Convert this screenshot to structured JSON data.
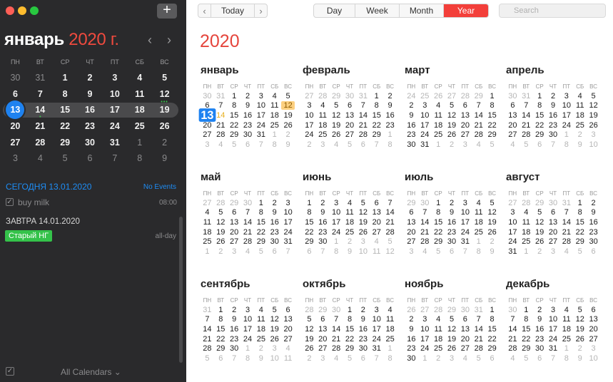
{
  "sidebar": {
    "add_label": "+",
    "mini_month": "январь",
    "mini_year": "2020 г.",
    "prev": "‹",
    "next": "›",
    "weekdays": [
      "ПН",
      "ВТ",
      "СР",
      "ЧТ",
      "ПТ",
      "СБ",
      "ВС"
    ],
    "weeks": [
      [
        {
          "d": "30",
          "out": true
        },
        {
          "d": "31",
          "out": true
        },
        {
          "d": "1"
        },
        {
          "d": "2"
        },
        {
          "d": "3"
        },
        {
          "d": "4"
        },
        {
          "d": "5"
        }
      ],
      [
        {
          "d": "6"
        },
        {
          "d": "7"
        },
        {
          "d": "8"
        },
        {
          "d": "9"
        },
        {
          "d": "10"
        },
        {
          "d": "11"
        },
        {
          "d": "12",
          "dots": "•••"
        }
      ],
      [
        {
          "d": "13",
          "today": true
        },
        {
          "d": "14",
          "dot": "•"
        },
        {
          "d": "15"
        },
        {
          "d": "16"
        },
        {
          "d": "17"
        },
        {
          "d": "18"
        },
        {
          "d": "19"
        }
      ],
      [
        {
          "d": "20"
        },
        {
          "d": "21"
        },
        {
          "d": "22"
        },
        {
          "d": "23"
        },
        {
          "d": "24"
        },
        {
          "d": "25"
        },
        {
          "d": "26"
        }
      ],
      [
        {
          "d": "27"
        },
        {
          "d": "28"
        },
        {
          "d": "29"
        },
        {
          "d": "30"
        },
        {
          "d": "31"
        },
        {
          "d": "1",
          "out": true
        },
        {
          "d": "2",
          "out": true
        }
      ],
      [
        {
          "d": "3",
          "out": true
        },
        {
          "d": "4",
          "out": true
        },
        {
          "d": "5",
          "out": true
        },
        {
          "d": "6",
          "out": true
        },
        {
          "d": "7",
          "out": true
        },
        {
          "d": "8",
          "out": true
        },
        {
          "d": "9",
          "out": true
        }
      ]
    ],
    "today_header": "СЕГОДНЯ 13.01.2020",
    "no_events": "No Events",
    "event1": {
      "title": "buy milk",
      "time": "08:00"
    },
    "tomorrow_header": "ЗАВТРА 14.01.2020",
    "event2": {
      "title": "Старый НГ",
      "time": "all-day"
    },
    "all_calendars": "All Calendars ⌄"
  },
  "toolbar": {
    "prev": "‹",
    "today": "Today",
    "next": "›",
    "views": [
      "Day",
      "Week",
      "Month",
      "Year"
    ],
    "active_view": "Year",
    "search_placeholder": "Search"
  },
  "year": "2020",
  "weekdays_short": [
    "ПН",
    "ВТ",
    "СР",
    "ЧТ",
    "ПТ",
    "СБ",
    "ВС"
  ],
  "months": [
    {
      "name": "январь",
      "weeks": [
        [
          "30*",
          "31*",
          "1",
          "2",
          "3",
          "4",
          "5"
        ],
        [
          "6",
          "7",
          "8",
          "9",
          "10",
          "11",
          "12y"
        ],
        [
          "13t",
          "14f",
          "15",
          "16",
          "17",
          "18",
          "19"
        ],
        [
          "20",
          "21",
          "22",
          "23",
          "24",
          "25",
          "26"
        ],
        [
          "27",
          "28",
          "29",
          "30",
          "31",
          "1*",
          "2*"
        ],
        [
          "3*",
          "4*",
          "5*",
          "6*",
          "7*",
          "8*",
          "9*"
        ]
      ]
    },
    {
      "name": "февраль",
      "weeks": [
        [
          "27*",
          "28*",
          "29*",
          "30*",
          "31*",
          "1",
          "2"
        ],
        [
          "3",
          "4",
          "5",
          "6",
          "7",
          "8",
          "9"
        ],
        [
          "10",
          "11",
          "12",
          "13",
          "14",
          "15",
          "16"
        ],
        [
          "17",
          "18",
          "19",
          "20",
          "21",
          "22",
          "23"
        ],
        [
          "24",
          "25",
          "26",
          "27",
          "28",
          "29",
          "1*"
        ],
        [
          "2*",
          "3*",
          "4*",
          "5*",
          "6*",
          "7*",
          "8*"
        ]
      ]
    },
    {
      "name": "март",
      "weeks": [
        [
          "24*",
          "25*",
          "26*",
          "27*",
          "28*",
          "29*",
          "1"
        ],
        [
          "2",
          "3",
          "4",
          "5",
          "6",
          "7",
          "8"
        ],
        [
          "9",
          "10",
          "11",
          "12",
          "13",
          "14",
          "15"
        ],
        [
          "16",
          "17",
          "18",
          "19",
          "20",
          "21",
          "22"
        ],
        [
          "23",
          "24",
          "25",
          "26",
          "27",
          "28",
          "29"
        ],
        [
          "30",
          "31",
          "1*",
          "2*",
          "3*",
          "4*",
          "5*"
        ]
      ]
    },
    {
      "name": "апрель",
      "weeks": [
        [
          "30*",
          "31*",
          "1",
          "2",
          "3",
          "4",
          "5"
        ],
        [
          "6",
          "7",
          "8",
          "9",
          "10",
          "11",
          "12"
        ],
        [
          "13",
          "14",
          "15",
          "16",
          "17",
          "18",
          "19"
        ],
        [
          "20",
          "21",
          "22",
          "23",
          "24",
          "25",
          "26"
        ],
        [
          "27",
          "28",
          "29",
          "30",
          "1*",
          "2*",
          "3*"
        ],
        [
          "4*",
          "5*",
          "6*",
          "7*",
          "8*",
          "9*",
          "10*"
        ]
      ]
    },
    {
      "name": "май",
      "weeks": [
        [
          "27*",
          "28*",
          "29*",
          "30*",
          "1",
          "2",
          "3"
        ],
        [
          "4",
          "5",
          "6",
          "7",
          "8",
          "9",
          "10"
        ],
        [
          "11",
          "12",
          "13",
          "14",
          "15",
          "16",
          "17"
        ],
        [
          "18",
          "19",
          "20",
          "21",
          "22",
          "23",
          "24"
        ],
        [
          "25",
          "26",
          "27",
          "28",
          "29",
          "30",
          "31"
        ],
        [
          "1*",
          "2*",
          "3*",
          "4*",
          "5*",
          "6*",
          "7*"
        ]
      ]
    },
    {
      "name": "июнь",
      "weeks": [
        [
          "1",
          "2",
          "3",
          "4",
          "5",
          "6",
          "7"
        ],
        [
          "8",
          "9",
          "10",
          "11",
          "12",
          "13",
          "14"
        ],
        [
          "15",
          "16",
          "17",
          "18",
          "19",
          "20",
          "21"
        ],
        [
          "22",
          "23",
          "24",
          "25",
          "26",
          "27",
          "28"
        ],
        [
          "29",
          "30",
          "1*",
          "2*",
          "3*",
          "4*",
          "5*"
        ],
        [
          "6*",
          "7*",
          "8*",
          "9*",
          "10*",
          "11*",
          "12*"
        ]
      ]
    },
    {
      "name": "июль",
      "weeks": [
        [
          "29*",
          "30*",
          "1",
          "2",
          "3",
          "4",
          "5"
        ],
        [
          "6",
          "7",
          "8",
          "9",
          "10",
          "11",
          "12"
        ],
        [
          "13",
          "14",
          "15",
          "16",
          "17",
          "18",
          "19"
        ],
        [
          "20",
          "21",
          "22",
          "23",
          "24",
          "25",
          "26"
        ],
        [
          "27",
          "28",
          "29",
          "30",
          "31",
          "1*",
          "2*"
        ],
        [
          "3*",
          "4*",
          "5*",
          "6*",
          "7*",
          "8*",
          "9*"
        ]
      ]
    },
    {
      "name": "август",
      "weeks": [
        [
          "27*",
          "28*",
          "29*",
          "30*",
          "31*",
          "1",
          "2"
        ],
        [
          "3",
          "4",
          "5",
          "6",
          "7",
          "8",
          "9"
        ],
        [
          "10",
          "11",
          "12",
          "13",
          "14",
          "15",
          "16"
        ],
        [
          "17",
          "18",
          "19",
          "20",
          "21",
          "22",
          "23"
        ],
        [
          "24",
          "25",
          "26",
          "27",
          "28",
          "29",
          "30"
        ],
        [
          "31",
          "1*",
          "2*",
          "3*",
          "4*",
          "5*",
          "6*"
        ]
      ]
    },
    {
      "name": "сентябрь",
      "weeks": [
        [
          "31*",
          "1",
          "2",
          "3",
          "4",
          "5",
          "6"
        ],
        [
          "7",
          "8",
          "9",
          "10",
          "11",
          "12",
          "13"
        ],
        [
          "14",
          "15",
          "16",
          "17",
          "18",
          "19",
          "20"
        ],
        [
          "21",
          "22",
          "23",
          "24",
          "25",
          "26",
          "27"
        ],
        [
          "28",
          "29",
          "30",
          "1*",
          "2*",
          "3*",
          "4*"
        ],
        [
          "5*",
          "6*",
          "7*",
          "8*",
          "9*",
          "10*",
          "11*"
        ]
      ]
    },
    {
      "name": "октябрь",
      "weeks": [
        [
          "28*",
          "29*",
          "30*",
          "1",
          "2",
          "3",
          "4"
        ],
        [
          "5",
          "6",
          "7",
          "8",
          "9",
          "10",
          "11"
        ],
        [
          "12",
          "13",
          "14",
          "15",
          "16",
          "17",
          "18"
        ],
        [
          "19",
          "20",
          "21",
          "22",
          "23",
          "24",
          "25"
        ],
        [
          "26",
          "27",
          "28",
          "29",
          "30",
          "31",
          "1*"
        ],
        [
          "2*",
          "3*",
          "4*",
          "5*",
          "6*",
          "7*",
          "8*"
        ]
      ]
    },
    {
      "name": "ноябрь",
      "weeks": [
        [
          "26*",
          "27*",
          "28*",
          "29*",
          "30*",
          "31*",
          "1"
        ],
        [
          "2",
          "3",
          "4",
          "5",
          "6",
          "7",
          "8"
        ],
        [
          "9",
          "10",
          "11",
          "12",
          "13",
          "14",
          "15"
        ],
        [
          "16",
          "17",
          "18",
          "19",
          "20",
          "21",
          "22"
        ],
        [
          "23",
          "24",
          "25",
          "26",
          "27",
          "28",
          "29"
        ],
        [
          "30",
          "1*",
          "2*",
          "3*",
          "4*",
          "5*",
          "6*"
        ]
      ]
    },
    {
      "name": "декабрь",
      "weeks": [
        [
          "30*",
          "1",
          "2",
          "3",
          "4",
          "5",
          "6"
        ],
        [
          "7",
          "8",
          "9",
          "10",
          "11",
          "12",
          "13"
        ],
        [
          "14",
          "15",
          "16",
          "17",
          "18",
          "19",
          "20"
        ],
        [
          "21",
          "22",
          "23",
          "24",
          "25",
          "26",
          "27"
        ],
        [
          "28",
          "29",
          "30",
          "31",
          "1*",
          "2*",
          "3*"
        ],
        [
          "4*",
          "5*",
          "6*",
          "7*",
          "8*",
          "9*",
          "10*"
        ]
      ]
    }
  ]
}
